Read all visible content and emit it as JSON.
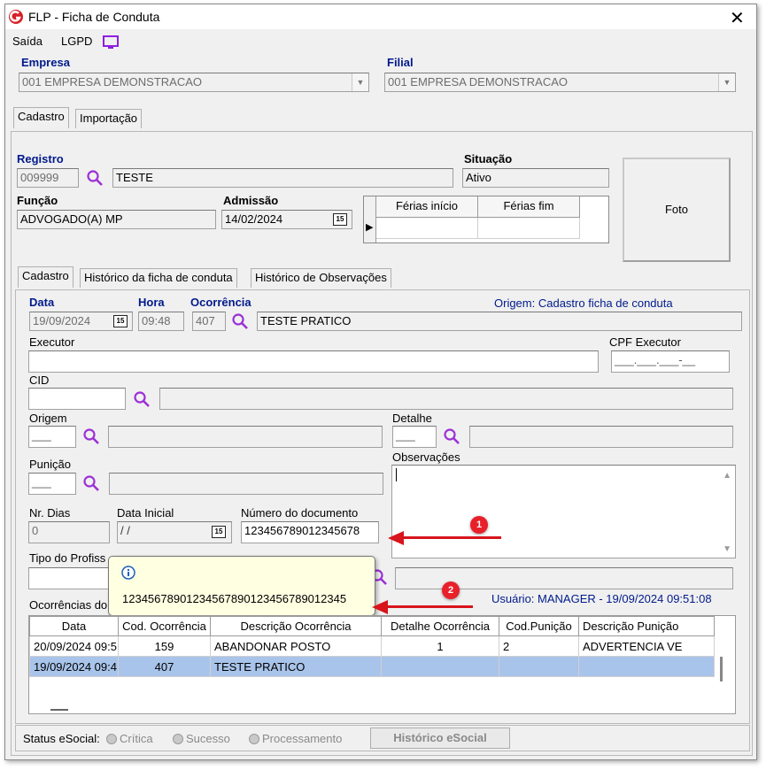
{
  "window": {
    "title": "FLP - Ficha de Conduta"
  },
  "menu": {
    "saida": "Saída",
    "lgpd": "LGPD"
  },
  "header": {
    "empresa_label": "Empresa",
    "empresa_value": "001 EMPRESA DEMONSTRACAO",
    "filial_label": "Filial",
    "filial_value": "001 EMPRESA DEMONSTRACAO"
  },
  "top_tabs": [
    "Cadastro",
    "Importação"
  ],
  "employee": {
    "registro_label": "Registro",
    "registro_code": "009999",
    "registro_name": "TESTE",
    "situacao_label": "Situação",
    "situacao_value": "Ativo",
    "funcao_label": "Função",
    "funcao_value": "ADVOGADO(A) MP",
    "admissao_label": "Admissão",
    "admissao_value": "14/02/2024",
    "ferias_inicio": "Férias início",
    "ferias_fim": "Férias fim",
    "foto": "Foto"
  },
  "inner_tabs": [
    "Cadastro",
    "Histórico da ficha de conduta",
    "Histórico de Observações"
  ],
  "form": {
    "data_label": "Data",
    "data_value": "19/09/2024",
    "hora_label": "Hora",
    "hora_value": "09:48",
    "ocorrencia_label": "Ocorrência",
    "ocorrencia_code": "407",
    "ocorrencia_desc": "TESTE PRATICO",
    "origem_info": "Origem: Cadastro ficha de conduta",
    "executor_label": "Executor",
    "cpf_label": "CPF Executor",
    "cpf_mask": "___.___.___-__",
    "cid_label": "CID",
    "origem_label": "Origem",
    "origem_mask": "___",
    "detalhe_label": "Detalhe",
    "detalhe_mask": "___",
    "punicao_label": "Punição",
    "punicao_mask": "___",
    "observacoes_label": "Observações",
    "nr_dias_label": "Nr. Dias",
    "nr_dias_value": "0",
    "data_inicial_label": "Data Inicial",
    "data_inicial_value": " / /",
    "numero_doc_label": "Número do documento",
    "numero_doc_value": "123456789012345678",
    "tipo_prof_label": "Tipo do Profiss",
    "ocorrencias_label": "Ocorrências do",
    "usuario_info": "Usuário: MANAGER - 19/09/2024 09:51:08"
  },
  "tooltip": {
    "text": "12345678901234567890123456789012345"
  },
  "table": {
    "headers": [
      "Data",
      "Cod. Ocorrência",
      "Descrição Ocorrência",
      "Detalhe Ocorrência",
      "Cod.Punição",
      "Descrição Punição"
    ],
    "rows": [
      [
        "20/09/2024 09:5...",
        "159",
        "ABANDONAR POSTO",
        "1",
        "2",
        "ADVERTENCIA VE"
      ],
      [
        "19/09/2024 09:4...",
        "407",
        "TESTE PRATICO",
        "",
        "",
        ""
      ]
    ]
  },
  "status": {
    "label": "Status eSocial:",
    "critica": "Crítica",
    "sucesso": "Sucesso",
    "processamento": "Processamento",
    "historico_btn": "Histórico eSocial"
  },
  "annotations": {
    "badge1": "1",
    "badge2": "2"
  },
  "colors": {
    "accent_blue": "#001a8c",
    "selected_row": "#a9c4ea",
    "arrow_red": "#d8141c",
    "tooltip_bg": "#ffffe1"
  }
}
